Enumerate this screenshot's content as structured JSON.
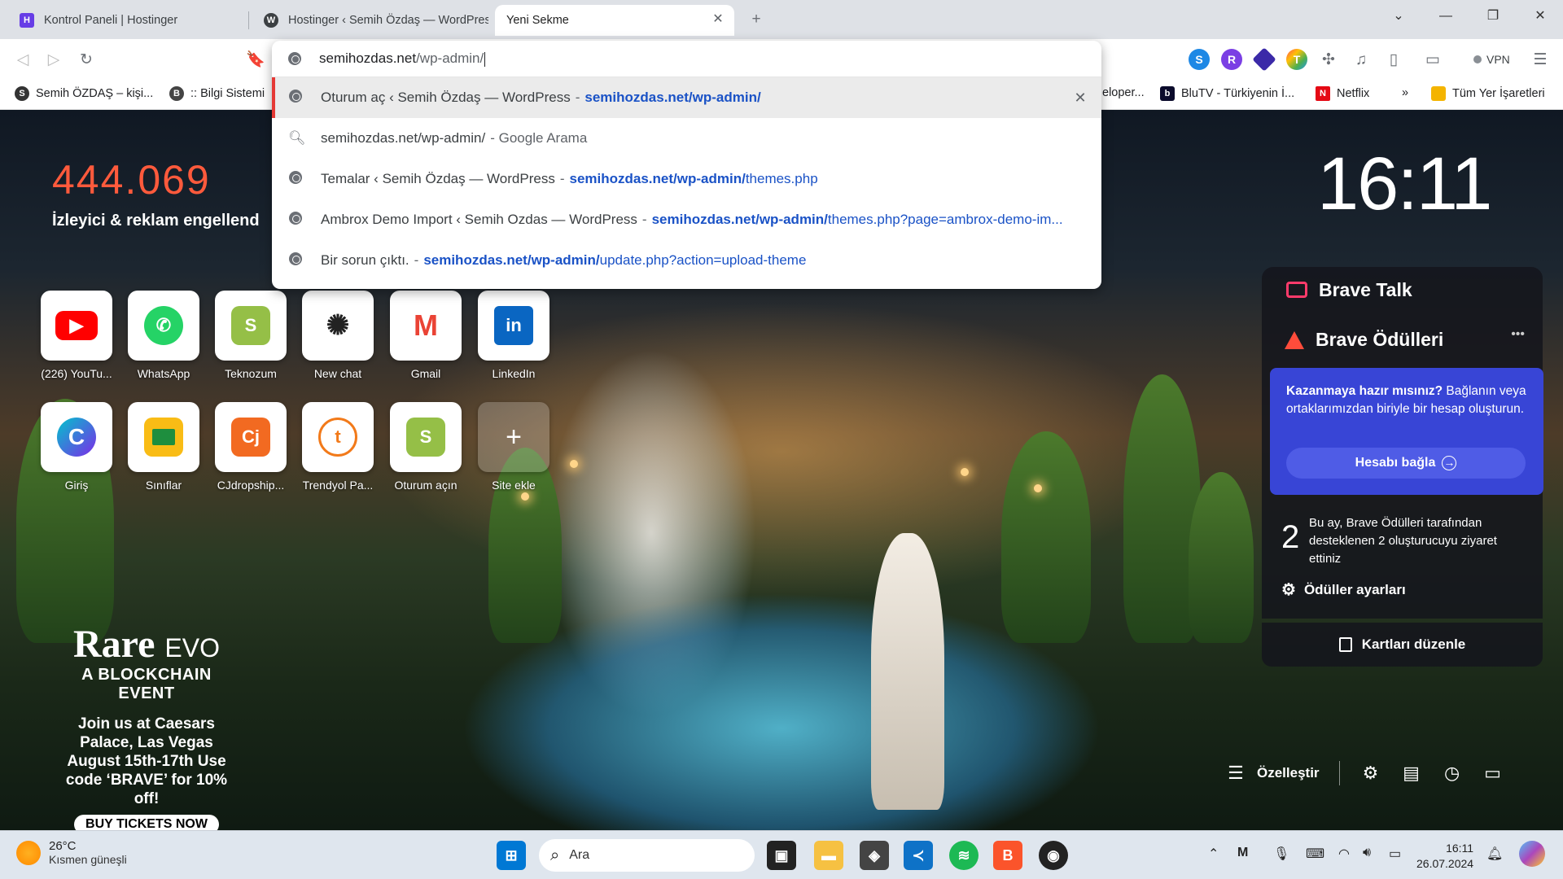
{
  "tabs": [
    {
      "title": "Kontrol Paneli | Hostinger",
      "icon": "hostinger-icon"
    },
    {
      "title": "Hostinger ‹ Semih Özdaş — WordPress",
      "icon": "wordpress-icon"
    },
    {
      "title": "Yeni Sekme",
      "icon": "none"
    }
  ],
  "omnibox": {
    "value_main": "semihozdas.net",
    "value_path": "/wp-admin/",
    "suggestions": [
      {
        "title": "Oturum aç ‹ Semih Özdaş — WordPress",
        "url_bold": "semihozdas.net/wp-admin/",
        "url_rest": ""
      },
      {
        "query": "semihozdas.net/wp-admin/",
        "engine": "- Google Arama"
      },
      {
        "title": "Temalar ‹ Semih Özdaş — WordPress",
        "url_bold": "semihozdas.net/wp-admin/",
        "url_rest": "themes.php"
      },
      {
        "title": "Ambrox Demo Import ‹ Semih Ozdas — WordPress",
        "url_bold": "semihozdas.net/wp-admin/",
        "url_rest": "themes.php?page=ambrox-demo-im..."
      },
      {
        "title": "Bir sorun çıktı.",
        "url_bold": "semihozdas.net/wp-admin/",
        "url_rest": "update.php?action=upload-theme"
      }
    ]
  },
  "bookmarks": {
    "left": [
      {
        "label": "Semih ÖZDAŞ – kişi..."
      },
      {
        "label": ":: Bilgi Sistemi"
      }
    ],
    "right": [
      {
        "label": "eloper..."
      },
      {
        "label": "BluTV - Türkiyenin İ..."
      },
      {
        "label": "Netflix"
      }
    ],
    "more": "»",
    "all": "Tüm Yer İşaretleri"
  },
  "toolbar": {
    "vpn": "VPN"
  },
  "stats": {
    "count": "444.069",
    "label": "İzleyici & reklam engellend"
  },
  "clock": "16:11",
  "top_sites": [
    {
      "label": "(226) YouTu...",
      "icon": "youtube-icon"
    },
    {
      "label": "WhatsApp",
      "icon": "whatsapp-icon"
    },
    {
      "label": "Teknozum",
      "icon": "shopify-icon"
    },
    {
      "label": "New chat",
      "icon": "chatgpt-icon"
    },
    {
      "label": "Gmail",
      "icon": "gmail-icon"
    },
    {
      "label": "LinkedIn",
      "icon": "linkedin-icon"
    },
    {
      "label": "Giriş",
      "icon": "canva-icon"
    },
    {
      "label": "Sınıflar",
      "icon": "classroom-icon"
    },
    {
      "label": "CJdropship...",
      "icon": "cjdropshipping-icon"
    },
    {
      "label": "Trendyol Pa...",
      "icon": "trendyol-icon"
    },
    {
      "label": "Oturum açın",
      "icon": "shopify-icon"
    },
    {
      "label": "Site ekle",
      "icon": "plus-icon"
    }
  ],
  "cards": {
    "talk_title": "Brave Talk",
    "rewards_title": "Brave Ödülleri",
    "rewards_more": "•••",
    "box_bold": "Kazanmaya hazır mısınız?",
    "box_text": " Bağlanın veya ortaklarımızdan biriyle bir hesap oluşturun.",
    "connect": "Hesabı bağla",
    "visit_count": "2",
    "visit_text": "Bu ay, Brave Ödülleri tarafından desteklenen 2 oluşturucuyu ziyaret ettiniz",
    "settings": "Ödüller ayarları",
    "edit": "Kartları düzenle"
  },
  "sponsor": {
    "brand": "Rare",
    "brand_suffix": "EVO",
    "sub": "A BLOCKCHAIN EVENT",
    "msg": "Join us at Caesars Palace, Las Vegas August 15th-17th Use code ‘BRAVE’ for 10% off!",
    "cta": "BUY TICKETS NOW"
  },
  "bottombar": {
    "customize": "Özelleştir"
  },
  "taskbar": {
    "temp": "26°C",
    "weather": "Kısmen güneşli",
    "search": "Ara",
    "time": "16:11",
    "date": "26.07.2024"
  }
}
